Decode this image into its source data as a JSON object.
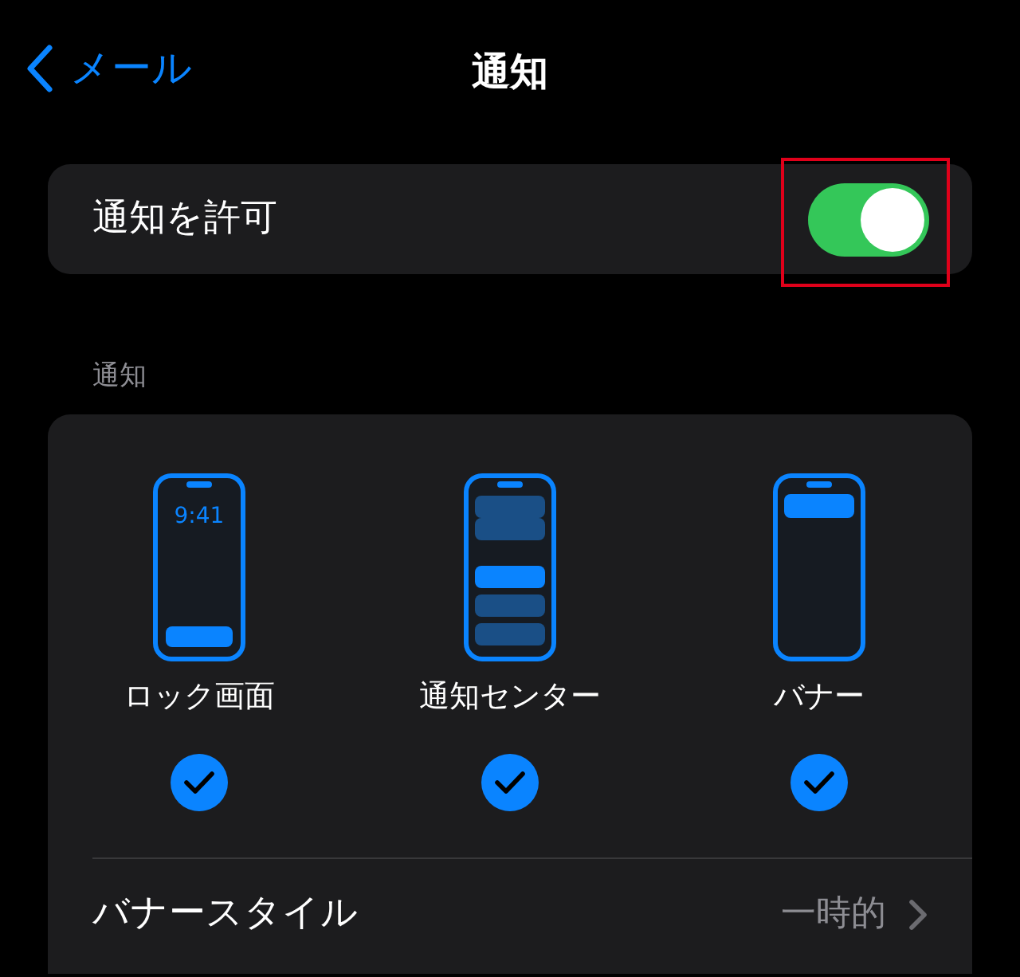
{
  "nav": {
    "back_label": "メール",
    "title": "通知"
  },
  "allow": {
    "label": "通知を許可",
    "on": true
  },
  "section_header": "通知",
  "styles": [
    {
      "kind": "lock",
      "label": "ロック画面",
      "time": "9:41",
      "checked": true
    },
    {
      "kind": "center",
      "label": "通知センター",
      "checked": true
    },
    {
      "kind": "banner",
      "label": "バナー",
      "checked": true
    }
  ],
  "banner_style": {
    "label": "バナースタイル",
    "value": "一時的"
  }
}
